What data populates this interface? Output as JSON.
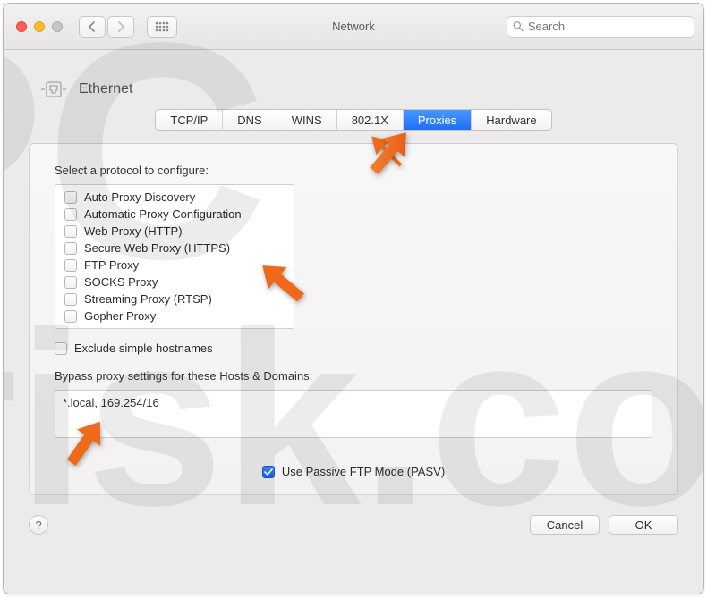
{
  "window": {
    "title": "Network",
    "search_placeholder": "Search"
  },
  "header": {
    "interface": "Ethernet"
  },
  "tabs": [
    "TCP/IP",
    "DNS",
    "WINS",
    "802.1X",
    "Proxies",
    "Hardware"
  ],
  "selected_tab_index": 4,
  "panel": {
    "select_label": "Select a protocol to configure:",
    "protocols": [
      "Auto Proxy Discovery",
      "Automatic Proxy Configuration",
      "Web Proxy (HTTP)",
      "Secure Web Proxy (HTTPS)",
      "FTP Proxy",
      "SOCKS Proxy",
      "Streaming Proxy (RTSP)",
      "Gopher Proxy"
    ],
    "exclude_label": "Exclude simple hostnames",
    "bypass_label": "Bypass proxy settings for these Hosts & Domains:",
    "bypass_value": "*.local, 169.254/16",
    "pasv_label": "Use Passive FTP Mode (PASV)",
    "pasv_checked": true
  },
  "buttons": {
    "help": "?",
    "cancel": "Cancel",
    "ok": "OK"
  }
}
